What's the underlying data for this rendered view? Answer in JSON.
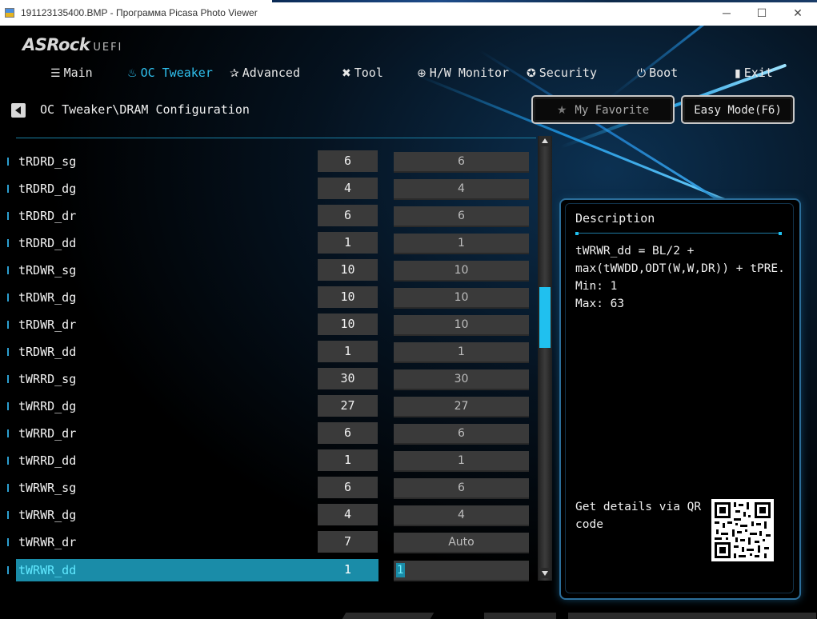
{
  "window": {
    "title": "191123135400.BMP - Программа Picasa Photo Viewer",
    "minimize": "─",
    "maximize": "☐",
    "close": "✕"
  },
  "bios": {
    "brand": "ASRock",
    "brand_suffix": "UEFI"
  },
  "nav": [
    {
      "label": "Main",
      "icon": "list-icon",
      "glyph": "☰",
      "active": false
    },
    {
      "label": "OC Tweaker",
      "icon": "flame-icon",
      "glyph": "♨",
      "active": true
    },
    {
      "label": "Advanced",
      "icon": "star-icon",
      "glyph": "✰",
      "active": false
    },
    {
      "label": "Tool",
      "icon": "tools-icon",
      "glyph": "✖",
      "active": false
    },
    {
      "label": "H/W Monitor",
      "icon": "monitor-icon",
      "glyph": "⊕",
      "active": false
    },
    {
      "label": "Security",
      "icon": "shield-icon",
      "glyph": "✪",
      "active": false
    },
    {
      "label": "Boot",
      "icon": "power-icon",
      "glyph": "⏻",
      "active": false
    },
    {
      "label": "Exit",
      "icon": "exit-door-icon",
      "glyph": "▮",
      "active": false
    }
  ],
  "breadcrumb": "OC Tweaker\\DRAM Configuration",
  "buttons": {
    "favorite": "My Favorite",
    "favorite_icon": "★",
    "easy_mode": "Easy Mode(F6)"
  },
  "rows": [
    {
      "label": "tRDRD_sg",
      "current": "6",
      "setting": "6"
    },
    {
      "label": "tRDRD_dg",
      "current": "4",
      "setting": "4"
    },
    {
      "label": "tRDRD_dr",
      "current": "6",
      "setting": "6"
    },
    {
      "label": "tRDRD_dd",
      "current": "1",
      "setting": "1"
    },
    {
      "label": "tRDWR_sg",
      "current": "10",
      "setting": "10"
    },
    {
      "label": "tRDWR_dg",
      "current": "10",
      "setting": "10"
    },
    {
      "label": "tRDWR_dr",
      "current": "10",
      "setting": "10"
    },
    {
      "label": "tRDWR_dd",
      "current": "1",
      "setting": "1"
    },
    {
      "label": "tWRRD_sg",
      "current": "30",
      "setting": "30"
    },
    {
      "label": "tWRRD_dg",
      "current": "27",
      "setting": "27"
    },
    {
      "label": "tWRRD_dr",
      "current": "6",
      "setting": "6"
    },
    {
      "label": "tWRRD_dd",
      "current": "1",
      "setting": "1"
    },
    {
      "label": "tWRWR_sg",
      "current": "6",
      "setting": "6"
    },
    {
      "label": "tWRWR_dg",
      "current": "4",
      "setting": "4"
    },
    {
      "label": "tWRWR_dr",
      "current": "7",
      "setting": "Auto"
    },
    {
      "label": "tWRWR_dd",
      "current": "1",
      "setting": "1",
      "selected": true
    }
  ],
  "description": {
    "title": "Description",
    "lines": [
      "tWRWR_dd = BL/2 +",
      "max(tWWDD,ODT(W,W,DR)) + tPRE.",
      "Min: 1",
      "Max: 63"
    ],
    "qr_text": "Get details via QR code"
  },
  "colors": {
    "accent": "#20c0ef",
    "selected_row": "#1a8ca8",
    "value_box": "#3a3a3a"
  }
}
